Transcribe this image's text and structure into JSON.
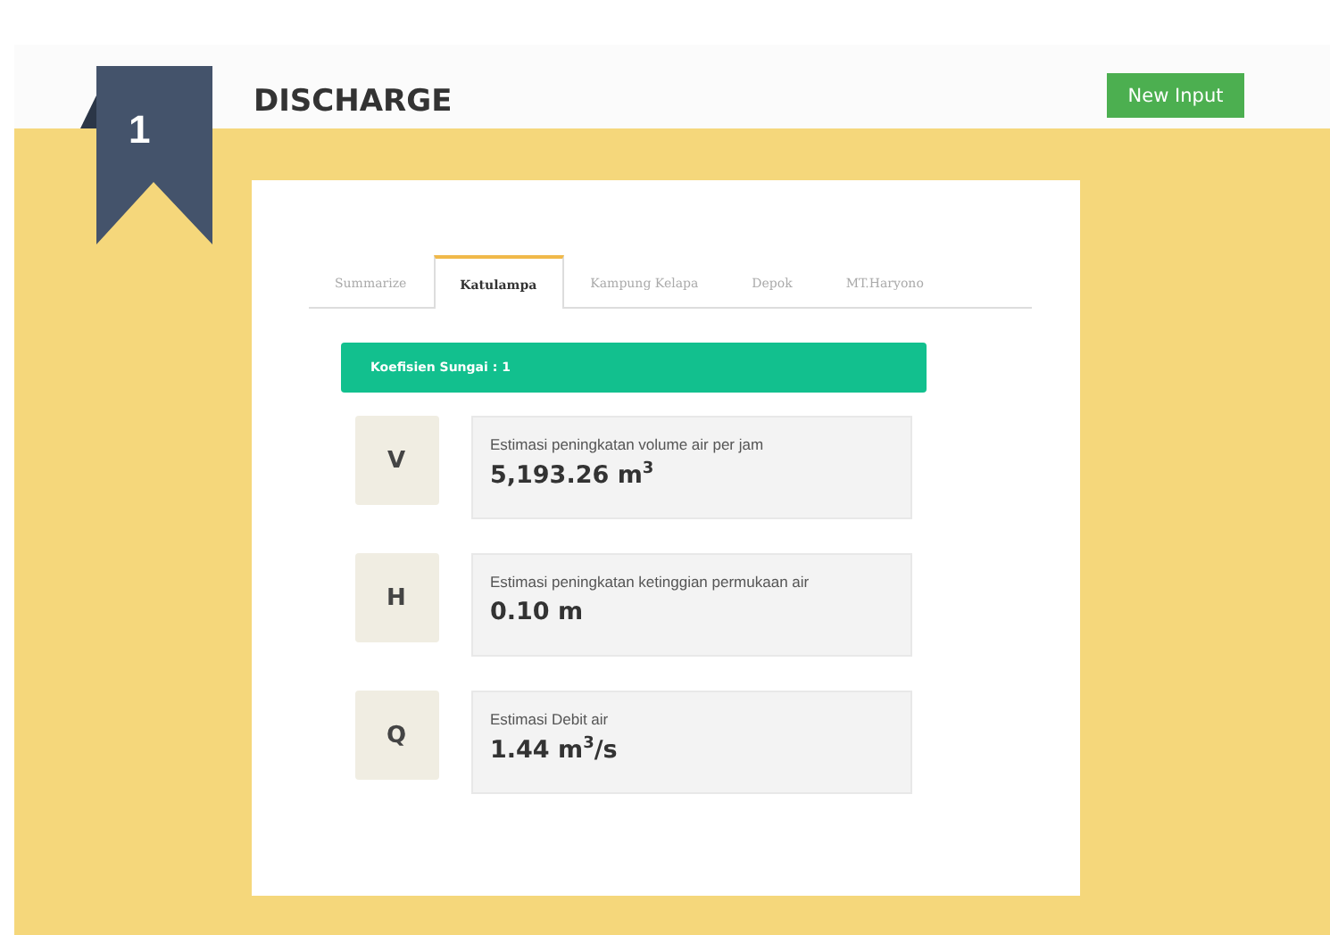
{
  "ribbon": {
    "number": "1"
  },
  "title": "DISCHARGE",
  "new_input_button": "New Input",
  "tabs": [
    {
      "label": "Summarize",
      "selected": false
    },
    {
      "label": "Katulampa",
      "selected": true
    },
    {
      "label": "Kampung Kelapa",
      "selected": false
    },
    {
      "label": "Depok",
      "selected": false
    },
    {
      "label": "MT.Haryono",
      "selected": false
    }
  ],
  "banner": "Koefisien Sungai : 1",
  "metrics": [
    {
      "symbol": "V",
      "description": "Estimasi peningkatan volume air per jam",
      "value": "5,193.26 m$^{3}$"
    },
    {
      "symbol": "H",
      "description": "Estimasi peningkatan ketinggian permukaan air",
      "value": "0.10 m"
    },
    {
      "symbol": "Q",
      "description": "Estimasi Debit air",
      "value": "1.44 m$^{3}$/s"
    }
  ]
}
